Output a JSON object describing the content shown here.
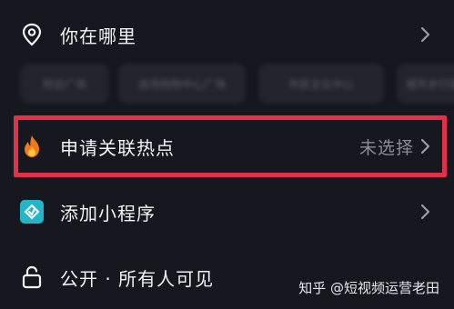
{
  "location": {
    "label": "你在哪里",
    "icon": "location-pin-icon"
  },
  "suggestions": [
    {
      "label": "附近广场"
    },
    {
      "label": "商场购物中心广场"
    },
    {
      "label": "市民文化中心"
    },
    {
      "label": "城市步行街"
    }
  ],
  "hotspot": {
    "label": "申请关联热点",
    "value": "未选择",
    "icon": "flame-icon"
  },
  "miniapp": {
    "label": "添加小程序",
    "icon": "mini-program-icon"
  },
  "visibility": {
    "label": "公开 · 所有人可见",
    "icon": "unlock-icon"
  },
  "watermark": {
    "text": "知乎 @短视频运营老田"
  },
  "colors": {
    "background": "#16171f",
    "highlight_border": "#e2304b",
    "mini_program": "#24b5c9",
    "flame": "#f07a1a",
    "muted_text": "#8c8d96"
  }
}
